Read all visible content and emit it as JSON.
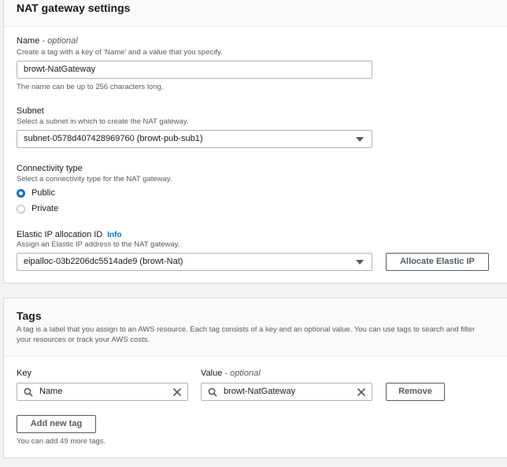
{
  "nat": {
    "title": "NAT gateway settings",
    "name": {
      "label": "Name",
      "optional": "- optional",
      "description": "Create a tag with a key of 'Name' and a value that you specify.",
      "value": "browt-NatGateway",
      "hint": "The name can be up to 256 characters long."
    },
    "subnet": {
      "label": "Subnet",
      "description": "Select a subnet in which to create the NAT gateway.",
      "value": "subnet-0578d407428969760 (browt-pub-sub1)"
    },
    "connectivity": {
      "label": "Connectivity type",
      "description": "Select a connectivity type for the NAT gateway.",
      "options": [
        "Public",
        "Private"
      ],
      "selected": "Public"
    },
    "eip": {
      "label": "Elastic IP allocation ID",
      "info": "Info",
      "description": "Assign an Elastic IP address to the NAT gateway.",
      "value": "eipalloc-03b2206dc5514ade9 (browt-Nat)",
      "allocate_button": "Allocate Elastic IP"
    }
  },
  "tags": {
    "title": "Tags",
    "description_line1": "A tag is a label that you assign to an AWS resource. Each tag consists of a key and an optional value. You can use tags to search and filter",
    "description_line2": "your resources or track your AWS costs.",
    "key_label": "Key",
    "value_label": "Value",
    "value_optional": "- optional",
    "rows": [
      {
        "key": "Name",
        "value": "browt-NatGateway",
        "remove_label": "Remove"
      }
    ],
    "add_button": "Add new tag",
    "limit_text": "You can add 49 more tags."
  },
  "colors": {
    "accent": "#0073bb",
    "page_bg": "#f2f3f3",
    "border": "#aab7b8"
  },
  "icons": [
    "search-icon",
    "clear-icon",
    "caret-down-icon",
    "radio-icon"
  ]
}
